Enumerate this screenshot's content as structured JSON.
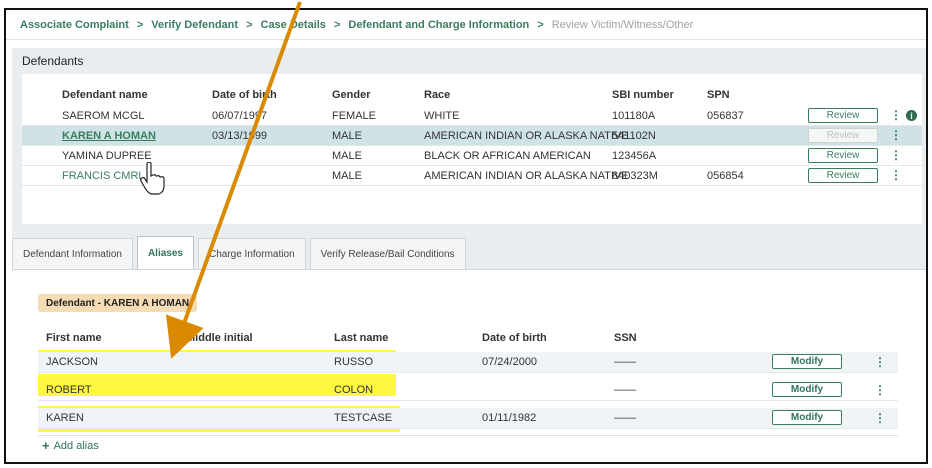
{
  "breadcrumb": {
    "items": [
      "Associate Complaint",
      "Verify Defendant",
      "Case Details",
      "Defendant and Charge Information",
      "Review Victim/Witness/Other"
    ],
    "separator": ">"
  },
  "defendants": {
    "title": "Defendants",
    "columns": [
      "Defendant name",
      "Date of birth",
      "Gender",
      "Race",
      "SBI number",
      "SPN"
    ],
    "rows": [
      {
        "name": "SAEROM MCGL",
        "dob": "06/07/1997",
        "gender": "FEMALE",
        "race": "WHITE",
        "sbi": "101180A",
        "spn": "056837",
        "action": "Review"
      },
      {
        "name": "KAREN A HOMAN",
        "dob": "03/13/1999",
        "gender": "MALE",
        "race": "AMERICAN INDIAN OR ALASKA NATIVE",
        "sbi": "541102N",
        "spn": "",
        "action": "Review"
      },
      {
        "name": "YAMINA DUPREE",
        "dob": "",
        "gender": "MALE",
        "race": "BLACK OR AFRICAN AMERICAN",
        "sbi": "123456A",
        "spn": "",
        "action": "Review"
      },
      {
        "name": "FRANCIS CMRL",
        "dob": "",
        "gender": "MALE",
        "race": "AMERICAN INDIAN OR ALASKA NATIVE",
        "sbi": "840323M",
        "spn": "056854",
        "action": "Review"
      }
    ],
    "info_icon": "i"
  },
  "tabs": [
    "Defendant Information",
    "Aliases",
    "Charge Information",
    "Verify Release/Bail Conditions"
  ],
  "aliases": {
    "defendant_label": "Defendant - KAREN A HOMAN",
    "columns": [
      "First name",
      "Middle initial",
      "Last name",
      "Date of birth",
      "SSN"
    ],
    "rows": [
      {
        "first": "JACKSON",
        "middle": "",
        "last": "RUSSO",
        "dob": "07/24/2000",
        "ssn": "——",
        "action": "Modify"
      },
      {
        "first": "ROBERT",
        "middle": "",
        "last": "COLON",
        "dob": "",
        "ssn": "——",
        "action": "Modify"
      },
      {
        "first": "KAREN",
        "middle": "",
        "last": "TESTCASE",
        "dob": "01/11/1982",
        "ssn": "——",
        "action": "Modify"
      }
    ],
    "add_label": "Add alias"
  },
  "colors": {
    "accent": "#3a7d5d",
    "highlight": "#fff500",
    "arrow": "#d98a00",
    "selected_row": "#cfe3e6",
    "badge": "#f6dcb5"
  }
}
